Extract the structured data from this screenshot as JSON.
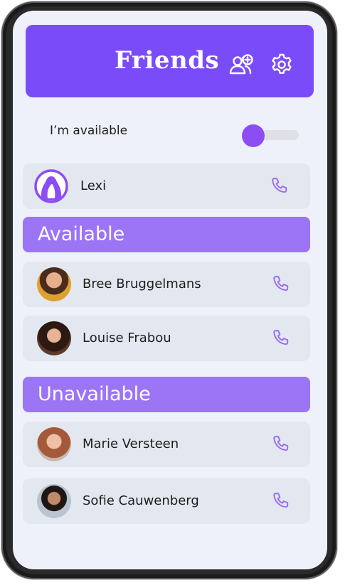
{
  "header": {
    "title": "Friends",
    "icons": [
      "add-friend-icon",
      "settings-icon"
    ]
  },
  "availability": {
    "label": "I’m available",
    "enabled": true
  },
  "me": {
    "name": "Lexi"
  },
  "sections": [
    {
      "label": "Available",
      "friends": [
        {
          "name": "Bree Bruggelmans"
        },
        {
          "name": "Louise Frabou"
        }
      ]
    },
    {
      "label": "Unavailable",
      "friends": [
        {
          "name": "Marie Versteen"
        },
        {
          "name": "Sofie Cauwenberg"
        }
      ]
    }
  ],
  "colors": {
    "accent": "#7a4cf9",
    "section": "#9c75f5",
    "card": "#e3e8f0",
    "background": "#eef1fa"
  }
}
